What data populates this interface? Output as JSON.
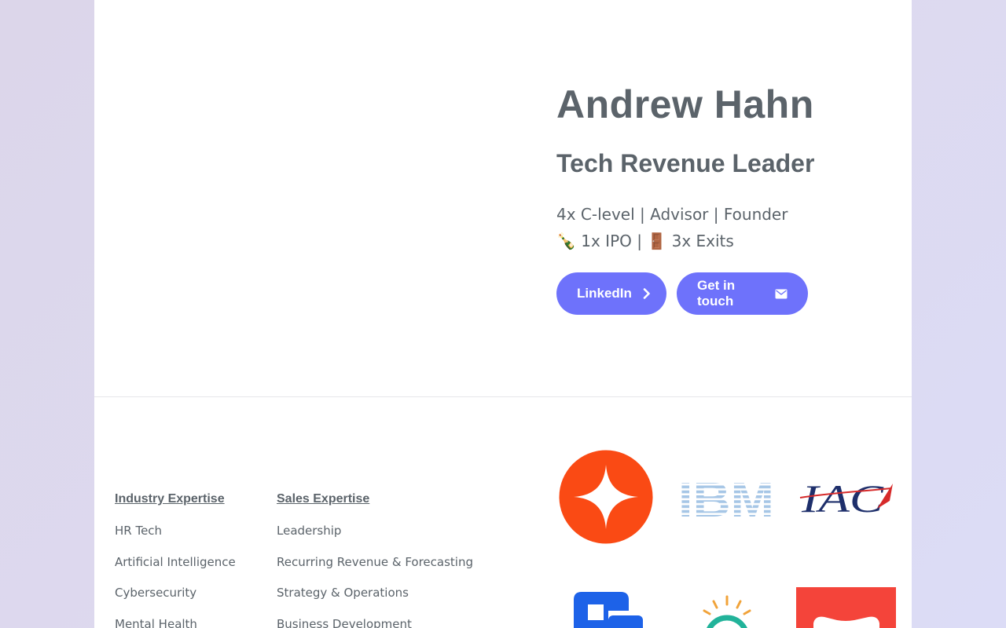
{
  "profile": {
    "name": "Andrew Hahn",
    "tagline": "Tech Revenue Leader",
    "bio_line1": "4x C-level | Advisor | Founder",
    "bio_line2_ipo_emoji": "🍾",
    "bio_line2_ipo": "1x IPO |",
    "bio_line2_exit_emoji": "🚪",
    "bio_line2_exits": "3x Exits"
  },
  "buttons": {
    "linkedin_label": "LinkedIn",
    "linkedin_icon": "chevron-right-icon",
    "contact_label": "Get in touch",
    "contact_icon": "envelope-icon"
  },
  "expertise": {
    "industry": {
      "title": "Industry Expertise",
      "items": [
        "HR Tech",
        "Artificial Intelligence",
        "Cybersecurity",
        "Mental Health"
      ]
    },
    "sales": {
      "title": "Sales Expertise",
      "items": [
        "Leadership",
        "Recurring Revenue & Forecasting",
        "Strategy & Operations",
        "Business Development"
      ]
    }
  },
  "logos": {
    "glean": "glean-logo",
    "ibm_text": "IBM",
    "iac_text": "IAC",
    "blue": "blue-logo",
    "bulb": "lightbulb-logo",
    "red": "red-logo"
  },
  "colors": {
    "button": "#6e72fb",
    "text": "#5b636a",
    "glean_orange": "#fa4a14",
    "ibm_blue": "#1f70c1",
    "iac_navy": "#1e2f6b",
    "iac_red": "#d62a2a",
    "red_logo": "#f4443a"
  }
}
